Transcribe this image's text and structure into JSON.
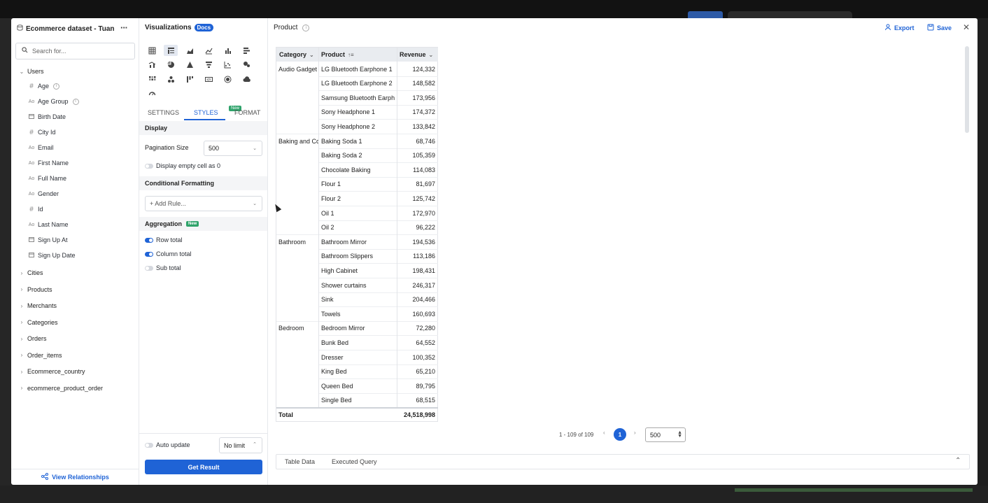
{
  "dataset": {
    "title": "Ecommerce dataset - Tuan",
    "search_placeholder": "Search for...",
    "users_model": "Users",
    "fields": [
      {
        "type": "#",
        "name": "Age",
        "info": true
      },
      {
        "type": "Ao",
        "name": "Age Group",
        "info": true
      },
      {
        "type": "cal",
        "name": "Birth Date",
        "info": false
      },
      {
        "type": "#",
        "name": "City Id",
        "info": false
      },
      {
        "type": "Ao",
        "name": "Email",
        "info": false
      },
      {
        "type": "Ao",
        "name": "First Name",
        "info": false
      },
      {
        "type": "Ao",
        "name": "Full Name",
        "info": false
      },
      {
        "type": "Ao",
        "name": "Gender",
        "info": false
      },
      {
        "type": "#",
        "name": "Id",
        "info": false
      },
      {
        "type": "Ao",
        "name": "Last Name",
        "info": false
      },
      {
        "type": "cal",
        "name": "Sign Up At",
        "info": false
      },
      {
        "type": "cal",
        "name": "Sign Up Date",
        "info": false
      }
    ],
    "models": [
      "Cities",
      "Products",
      "Merchants",
      "Categories",
      "Orders",
      "Order_items",
      "Ecommerce_country",
      "ecommerce_product_order"
    ],
    "view_relationships": "View Relationships"
  },
  "viz": {
    "title": "Visualizations",
    "docs": "Docs",
    "tabs": {
      "settings": "SETTINGS",
      "styles": "STYLES",
      "format": "FORMAT",
      "new_badge": "New"
    },
    "display": {
      "section": "Display",
      "pagination_label": "Pagination Size",
      "pagination_value": "500",
      "empty_cell_label": "Display empty cell as 0"
    },
    "conditional": {
      "section": "Conditional Formatting",
      "add_rule": "+ Add Rule..."
    },
    "aggregation": {
      "section": "Aggregation",
      "badge": "New",
      "row_total": "Row total",
      "column_total": "Column total",
      "sub_total": "Sub total"
    },
    "auto_update": "Auto update",
    "limit": "No limit",
    "get_result": "Get Result"
  },
  "result": {
    "title": "Product",
    "export": "Export",
    "save": "Save",
    "headers": {
      "category": "Category",
      "product": "Product",
      "revenue": "Revenue"
    },
    "groups": [
      {
        "category": "Audio Gadget",
        "rows": [
          [
            "LG Bluetooth Earphone 1",
            "124,332"
          ],
          [
            "LG Bluetooth Earphone 2",
            "148,582"
          ],
          [
            "Samsung Bluetooth Earph",
            "173,956"
          ],
          [
            "Sony Headphone 1",
            "174,372"
          ],
          [
            "Sony Headphone 2",
            "133,842"
          ]
        ]
      },
      {
        "category": "Baking and Cc",
        "rows": [
          [
            "Baking Soda 1",
            "68,746"
          ],
          [
            "Baking Soda 2",
            "105,359"
          ],
          [
            "Chocolate Baking",
            "114,083"
          ],
          [
            "Flour 1",
            "81,697"
          ],
          [
            "Flour 2",
            "125,742"
          ],
          [
            "Oil 1",
            "172,970"
          ],
          [
            "Oil 2",
            "96,222"
          ]
        ]
      },
      {
        "category": "Bathroom",
        "rows": [
          [
            "Bathroom Mirror",
            "194,536"
          ],
          [
            "Bathroom Slippers",
            "113,186"
          ],
          [
            "High Cabinet",
            "198,431"
          ],
          [
            "Shower curtains",
            "246,317"
          ],
          [
            "Sink",
            "204,466"
          ],
          [
            "Towels",
            "160,693"
          ]
        ]
      },
      {
        "category": "Bedroom",
        "rows": [
          [
            "Bedroom Mirror",
            "72,280"
          ],
          [
            "Bunk Bed",
            "64,552"
          ],
          [
            "Dresser",
            "100,352"
          ],
          [
            "King Bed",
            "65,210"
          ],
          [
            "Queen Bed",
            "89,795"
          ],
          [
            "Single Bed",
            "68,515"
          ]
        ]
      }
    ],
    "total_label": "Total",
    "total_value": "24,518,998",
    "pagination": {
      "range": "1 - 109 of 109",
      "current": "1",
      "page_size": "500"
    },
    "bottom_tabs": [
      "Table Data",
      "Executed Query"
    ]
  }
}
